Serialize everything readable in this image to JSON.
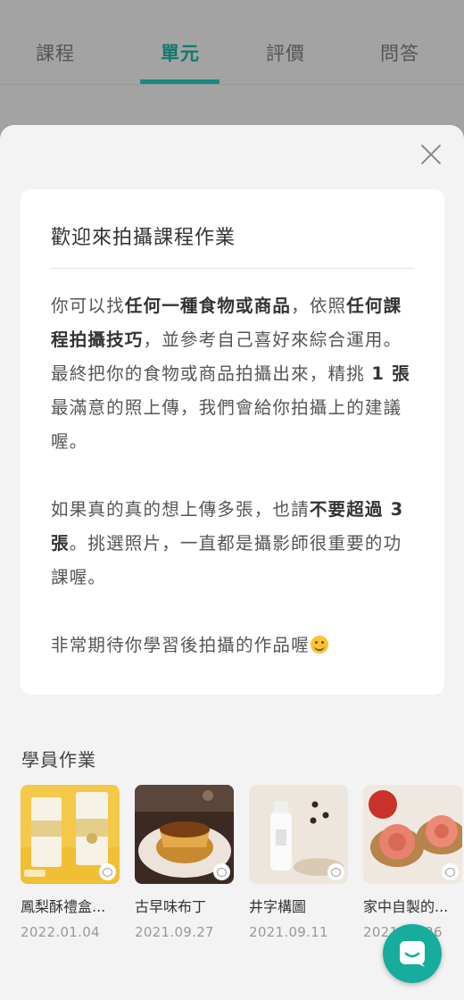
{
  "tabs": [
    {
      "label": "課程",
      "active": false
    },
    {
      "label": "單元",
      "active": true
    },
    {
      "label": "評價",
      "active": false
    },
    {
      "label": "問答",
      "active": false
    }
  ],
  "card": {
    "title": "歡迎來拍攝課程作業",
    "p1": [
      "你可以找",
      "任何一種食物或商品",
      "，依照",
      "任何課程拍攝技巧",
      "，並參考自己喜好來綜合運用。最終把你的食物或商品拍攝出來，精挑 ",
      "1 張",
      "最滿意的照上傳，我們會給你拍攝上的建議喔。"
    ],
    "p2": [
      "如果真的真的想上傳多張，也請",
      "不要超過 3 張",
      "。挑選照片，一直都是攝影師很重要的功課喔。"
    ],
    "p3": [
      "非常期待你學習後拍攝的作品喔"
    ]
  },
  "section_title": "學員作業",
  "homeworks": [
    {
      "title": "鳳梨酥禮盒...",
      "date": "2022.01.04"
    },
    {
      "title": "古早味布丁",
      "date": "2021.09.27"
    },
    {
      "title": "井字構圖",
      "date": "2021.09.11"
    },
    {
      "title": "家中自製的...",
      "date": "2021.09.26"
    }
  ],
  "colors": {
    "accent": "#1a8a7e",
    "fab": "#17ad9d"
  },
  "icons": {
    "close": "close-icon",
    "comment": "comment-icon",
    "chat": "chat-icon",
    "emoji": "smile-emoji-icon"
  }
}
